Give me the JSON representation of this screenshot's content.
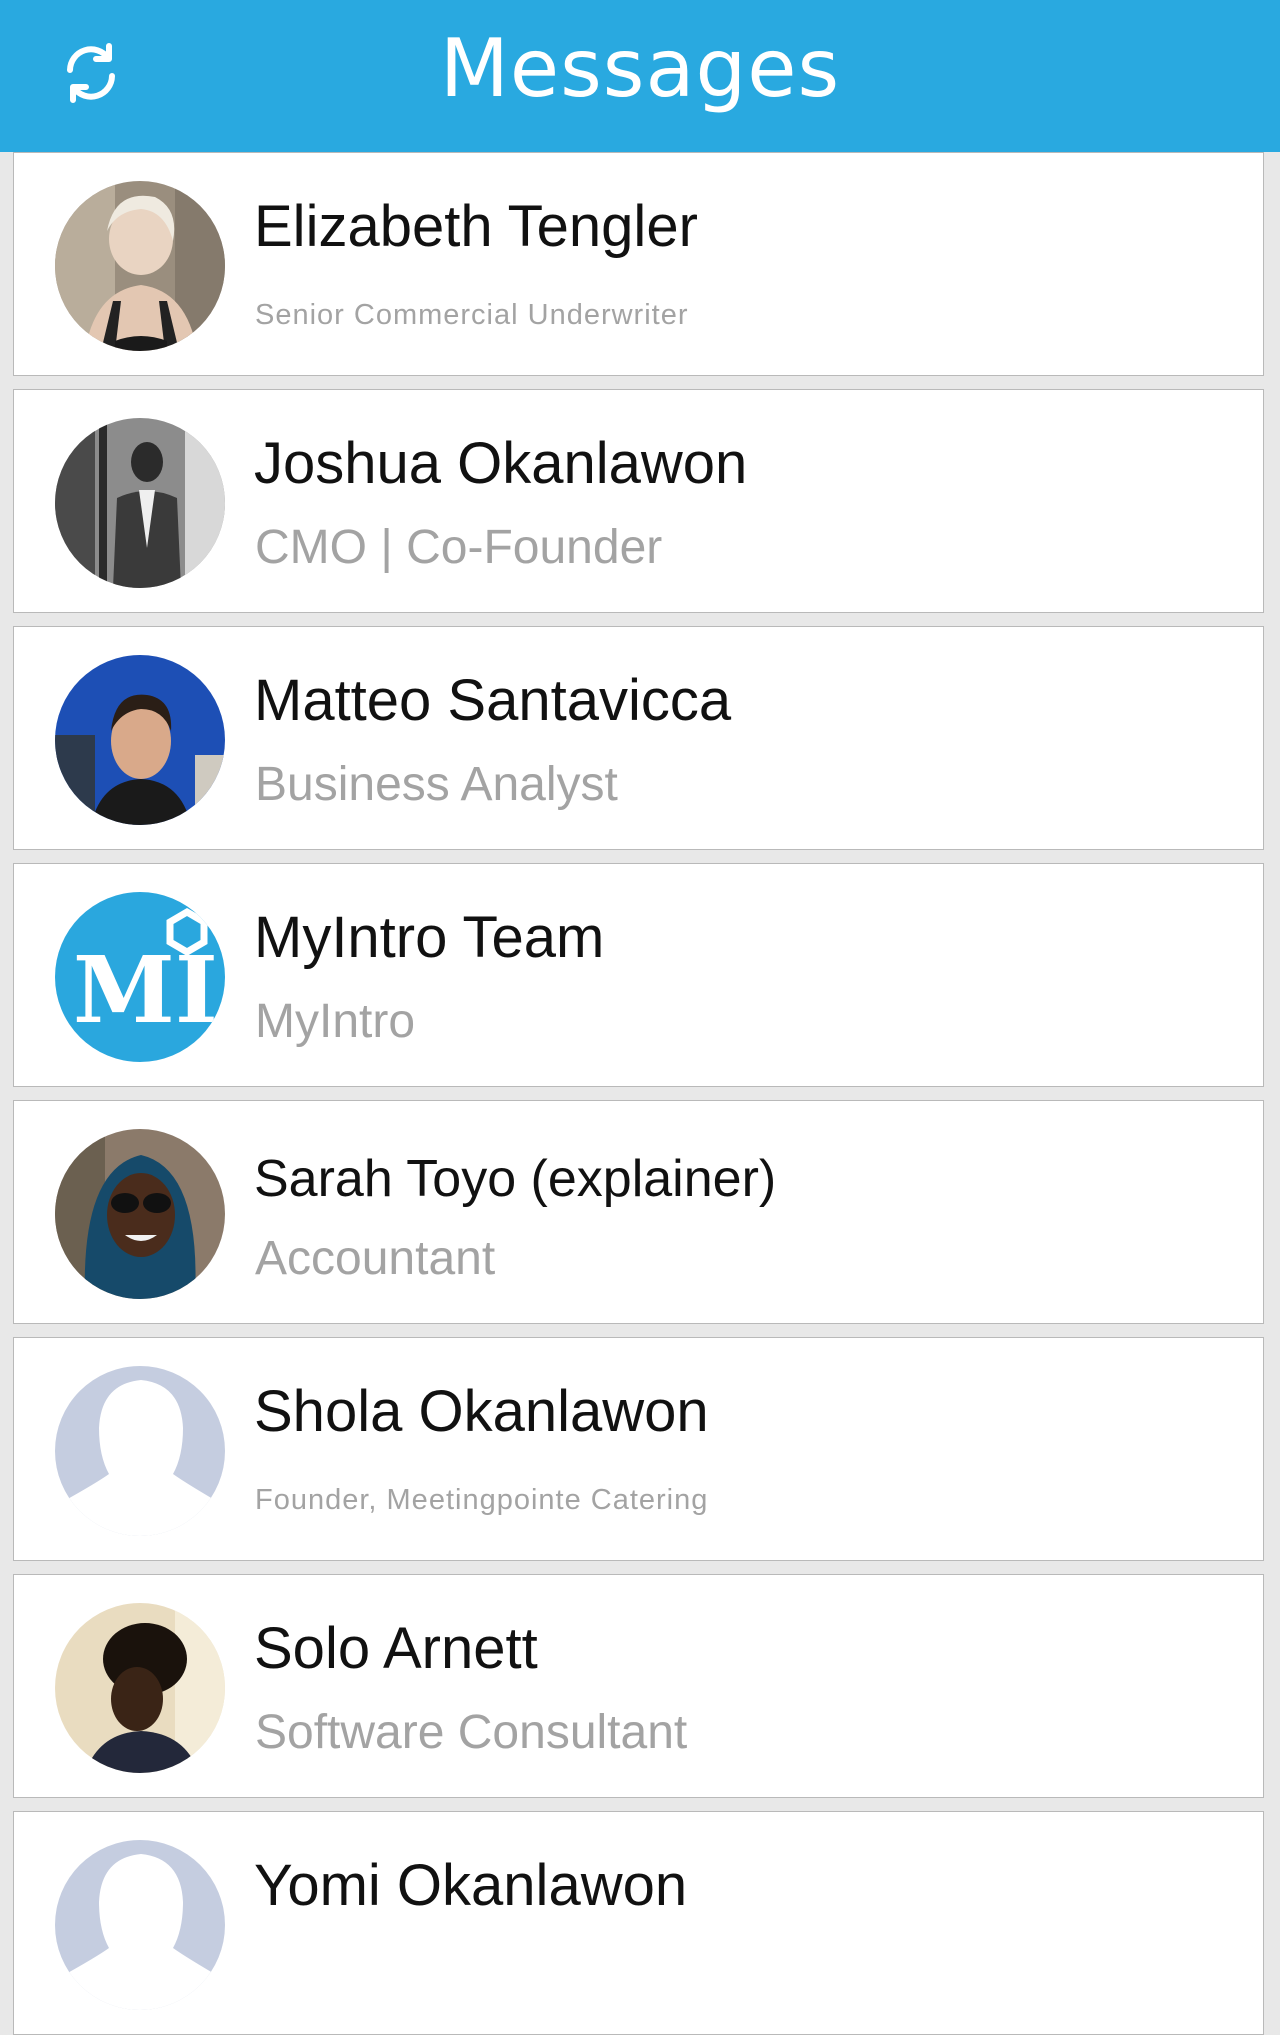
{
  "header": {
    "title": "Messages",
    "background_color": "#29a9e0",
    "refresh_icon": "refresh-icon"
  },
  "contacts": [
    {
      "name": "Elizabeth Tengler",
      "subtitle": "Senior Commercial Underwriter",
      "avatar": "photo"
    },
    {
      "name": "Joshua Okanlawon",
      "subtitle": "CMO | Co-Founder",
      "avatar": "photo"
    },
    {
      "name": "Matteo Santavicca",
      "subtitle": "Business Analyst",
      "avatar": "photo"
    },
    {
      "name": "MyIntro Team",
      "subtitle": "MyIntro",
      "avatar": "myintro-logo",
      "logo_text": "MI"
    },
    {
      "name": "Sarah Toyo (explainer)",
      "subtitle": "Accountant",
      "avatar": "photo"
    },
    {
      "name": "Shola Okanlawon",
      "subtitle": "Founder, Meetingpointe Catering",
      "avatar": "placeholder-silhouette"
    },
    {
      "name": "Solo Arnett",
      "subtitle": "Software Consultant",
      "avatar": "photo"
    },
    {
      "name": "Yomi Okanlawon",
      "subtitle": "",
      "avatar": "placeholder-silhouette"
    }
  ]
}
